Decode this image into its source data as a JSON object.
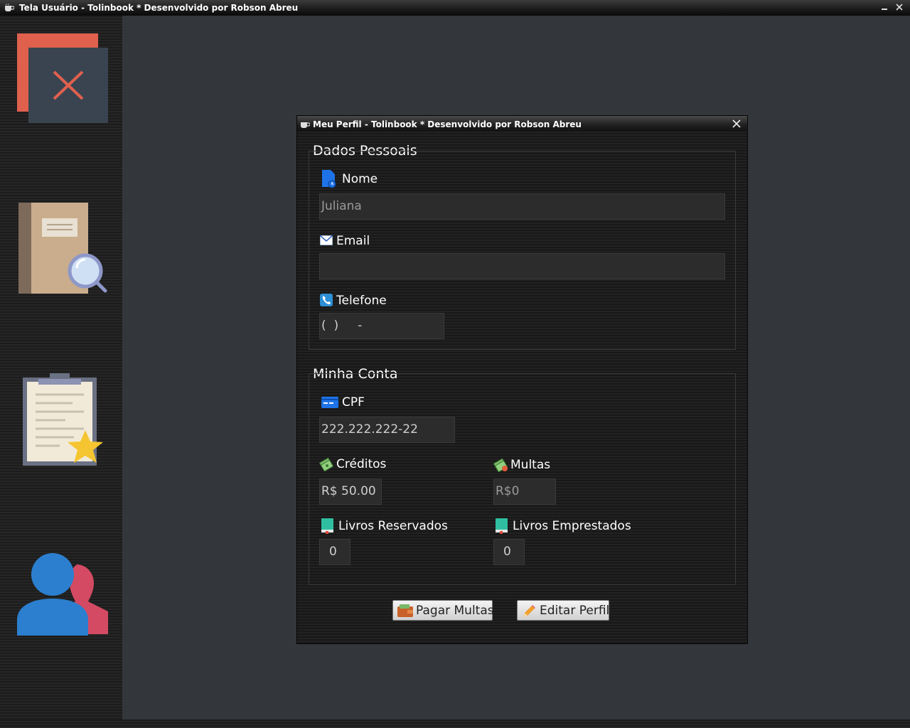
{
  "window": {
    "title": "Tela Usuário - Tolinbook * Desenvolvido por Robson Abreu"
  },
  "sidebar": {
    "items": [
      {
        "icon": "close-icon"
      },
      {
        "icon": "book-search-icon"
      },
      {
        "icon": "clipboard-star-icon"
      },
      {
        "icon": "users-icon"
      }
    ]
  },
  "dialog": {
    "title": "Meu Perfil - Tolinbook * Desenvolvido por Robson Abreu",
    "personal": {
      "title": "Dados Pessoais",
      "nome_label": "Nome",
      "nome_value": "Juliana",
      "email_label": "Email",
      "email_value": "",
      "telefone_label": "Telefone",
      "telefone_value": "(  )     -"
    },
    "account": {
      "title": "Minha Conta",
      "cpf_label": "CPF",
      "cpf_value": "222.222.222-22",
      "creditos_label": "Créditos",
      "creditos_value": "R$ 50.00",
      "multas_label": "Multas",
      "multas_value": "R$0",
      "reservados_label": "Livros Reservados",
      "reservados_value": "0",
      "emprestados_label": "Livros Emprestados",
      "emprestados_value": "0"
    },
    "buttons": {
      "pagar": "Pagar Multas",
      "editar": "Editar Perfil"
    }
  },
  "colors": {
    "background": "#33363b",
    "sidebar": "#1f1f1f",
    "dialog": "#1c1c1c",
    "field": "#2c2c2c",
    "accent_blue": "#1e73e8"
  }
}
